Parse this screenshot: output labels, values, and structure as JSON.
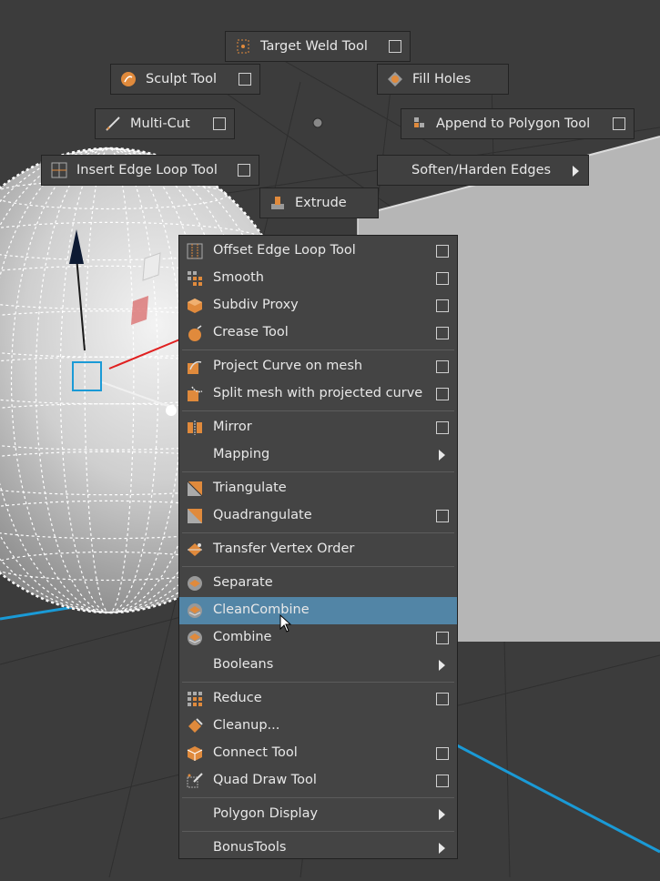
{
  "marking_menu": {
    "target_weld": {
      "label": "Target Weld Tool",
      "icon": "target-weld-icon",
      "checkbox": true
    },
    "sculpt": {
      "label": "Sculpt Tool",
      "icon": "sculpt-icon",
      "checkbox": true
    },
    "fill_holes": {
      "label": "Fill Holes",
      "icon": "fill-holes-icon"
    },
    "multi_cut": {
      "label": "Multi-Cut",
      "icon": "multi-cut-icon",
      "checkbox": true
    },
    "append_polygon": {
      "label": "Append to Polygon Tool",
      "icon": "append-polygon-icon",
      "checkbox": true
    },
    "insert_edge_loop": {
      "label": "Insert Edge Loop Tool",
      "icon": "insert-edge-loop-icon",
      "checkbox": true
    },
    "soften_harden": {
      "label": "Soften/Harden Edges",
      "submenu": true
    },
    "extrude": {
      "label": "Extrude",
      "icon": "extrude-icon"
    }
  },
  "menu": {
    "items": [
      {
        "label": "Offset Edge Loop Tool",
        "icon": "offset-edge-loop-icon",
        "checkbox": true
      },
      {
        "label": "Smooth",
        "icon": "smooth-icon",
        "checkbox": true
      },
      {
        "label": "Subdiv Proxy",
        "icon": "subdiv-proxy-icon",
        "checkbox": true
      },
      {
        "label": "Crease Tool",
        "icon": "crease-icon",
        "checkbox": true
      },
      {
        "label": "Project Curve on mesh",
        "icon": "project-curve-icon",
        "checkbox": true
      },
      {
        "label": "Split mesh with projected curve",
        "icon": "split-mesh-icon",
        "checkbox": true
      },
      {
        "label": "Mirror",
        "icon": "mirror-icon",
        "checkbox": true
      },
      {
        "label": "Mapping",
        "submenu": true
      },
      {
        "label": "Triangulate",
        "icon": "triangulate-icon"
      },
      {
        "label": "Quadrangulate",
        "icon": "quadrangulate-icon",
        "checkbox": true
      },
      {
        "label": "Transfer Vertex Order",
        "icon": "transfer-vertex-order-icon"
      },
      {
        "label": "Separate",
        "icon": "separate-icon"
      },
      {
        "label": "CleanCombine",
        "icon": "clean-combine-icon",
        "highlighted": true
      },
      {
        "label": "Combine",
        "icon": "combine-icon",
        "checkbox": true
      },
      {
        "label": "Booleans",
        "submenu": true
      },
      {
        "label": "Reduce",
        "icon": "reduce-icon",
        "checkbox": true
      },
      {
        "label": "Cleanup...",
        "icon": "cleanup-icon"
      },
      {
        "label": "Connect Tool",
        "icon": "connect-tool-icon",
        "checkbox": true
      },
      {
        "label": "Quad Draw Tool",
        "icon": "quad-draw-icon",
        "checkbox": true
      },
      {
        "label": "Polygon Display",
        "submenu": true
      },
      {
        "label": "BonusTools",
        "submenu": true
      }
    ]
  },
  "colors": {
    "highlight": "#5285a6",
    "icon_orange": "#e08a3c",
    "axis_blue": "#1a9ad6",
    "background": "#3c3c3c"
  }
}
